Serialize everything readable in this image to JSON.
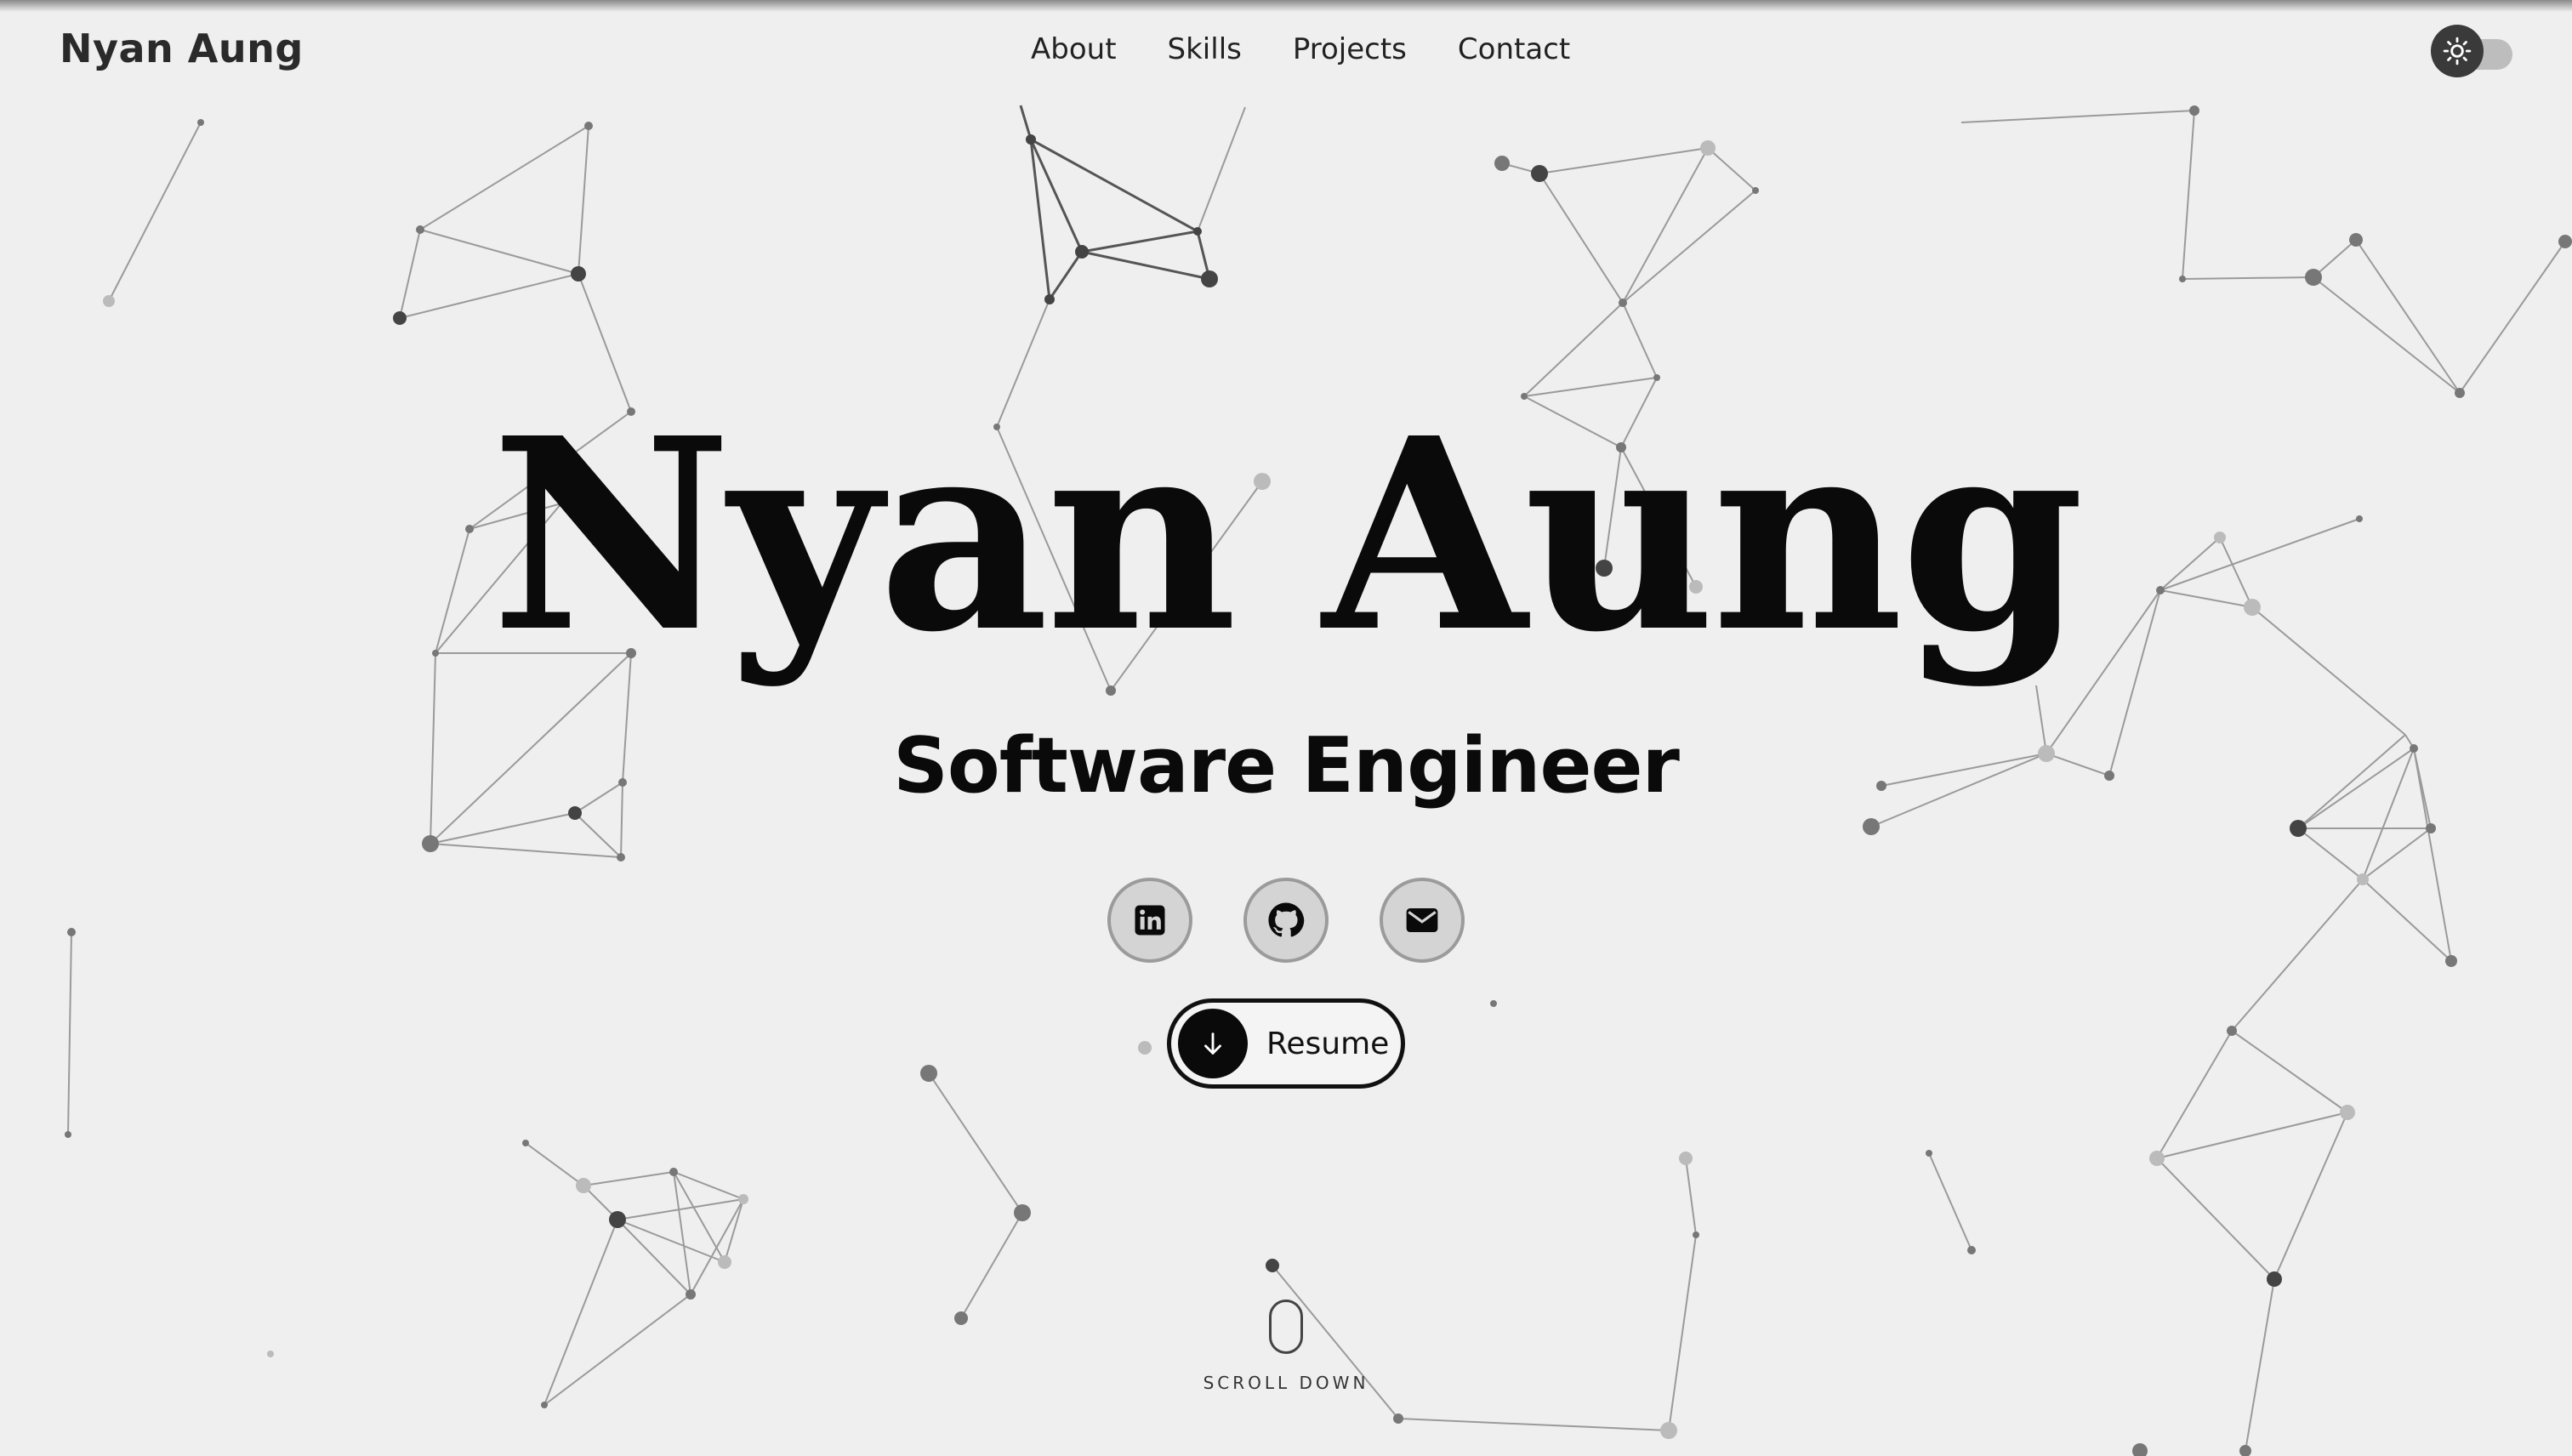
{
  "header": {
    "brand": "Nyan Aung",
    "nav": [
      {
        "label": "About"
      },
      {
        "label": "Skills"
      },
      {
        "label": "Projects"
      },
      {
        "label": "Contact"
      }
    ],
    "theme_toggle_icon": "sun-icon"
  },
  "hero": {
    "name": "Nyan Aung",
    "role": "Software Engineer",
    "socials": [
      {
        "icon": "linkedin-icon"
      },
      {
        "icon": "github-icon"
      },
      {
        "icon": "email-icon"
      }
    ],
    "resume_label": "Resume",
    "resume_icon": "arrow-down-icon",
    "scroll_label": "SCROLL DOWN",
    "scroll_icon": "mouse-icon"
  },
  "colors": {
    "background": "#efefef",
    "text": "#0a0a0a",
    "network": "#777777"
  }
}
